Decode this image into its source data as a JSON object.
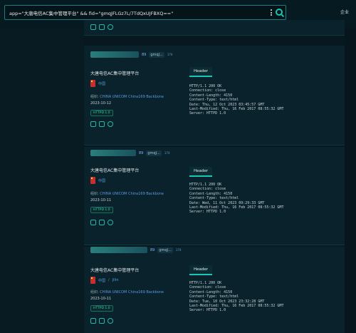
{
  "search": {
    "query": "app=\"大唐电信AC集中管理平台\" && fid=\"gmqJFLGz7L/7TdQxUJFBXQ==\"",
    "top_link": "企业"
  },
  "results": [
    {
      "host_link": "",
      "host_tag": "",
      "host_badge": "",
      "title": "",
      "country": "",
      "region": "",
      "org_prefix": "",
      "org": "",
      "date": "",
      "proto": "",
      "header_tab": "",
      "header_lines": []
    },
    {
      "host_link": "89",
      "host_tag": "gmqJ...",
      "host_badge": "174",
      "title": "大唐电信AC集中管理平台",
      "country": "中国",
      "region": "",
      "org_prefix": "组织:",
      "org": "CHINA UNICOM China169 Backbone",
      "date": "2023-10-12",
      "proto": "HTTPD 1.0",
      "header_tab": "Header",
      "header_lines": [
        "HTTP/1.1 200 OK",
        "Connection: close",
        "Content-Length: 4150",
        "Content-Type: text/html",
        "Date: Thu, 12 Oct 2023 03:45:57 GMT",
        "Last-Modified: Thu, 16 Feb 2017 08:55:32 GMT",
        "Server: HTTPD 1.0"
      ]
    },
    {
      "host_link": "89",
      "host_tag": "gmqJ...",
      "host_badge": "174",
      "title": "大唐电信AC集中管理平台",
      "country": "中国",
      "region": "",
      "org_prefix": "组织:",
      "org": "CHINA UNICOM China169 Backbone",
      "date": "2023-10-11",
      "proto": "HTTPD 1.0",
      "header_tab": "Header",
      "header_lines": [
        "HTTP/1.1 200 OK",
        "Connection: close",
        "Content-Length: 4150",
        "Content-Type: text/html",
        "Date: Wed, 11 Oct 2023 09:29:33 GMT",
        "Last-Modified: Thu, 16 Feb 2017 08:55:32 GMT",
        "Server: HTTPD 1.0"
      ]
    },
    {
      "host_link": "89",
      "host_tag": "gmqJ...",
      "host_badge": "174",
      "title": "大唐电信AC集中管理平台",
      "country": "中国",
      "region": "Jilin",
      "org_prefix": "组织:",
      "org": "CHINA UNICOM China169 Backbone",
      "date": "2023-10-11",
      "proto": "HTTPD 1.0",
      "header_tab": "Header",
      "header_lines": [
        "HTTP/1.1 200 OK",
        "Connection: close",
        "Content-Length: 4150",
        "Content-Type: text/html",
        "Date: Tue, 10 Oct 2023 23:32:28 GMT",
        "Last-Modified: Thu, 16 Feb 2017 08:55:32 GMT",
        "Server: HTTPD 1.0"
      ]
    }
  ],
  "icons": [
    "screenshot-icon",
    "scan-icon",
    "refresh-icon"
  ],
  "colors": {
    "accent": "#19c6b5",
    "link": "#5a9be0",
    "background": "#071820"
  }
}
